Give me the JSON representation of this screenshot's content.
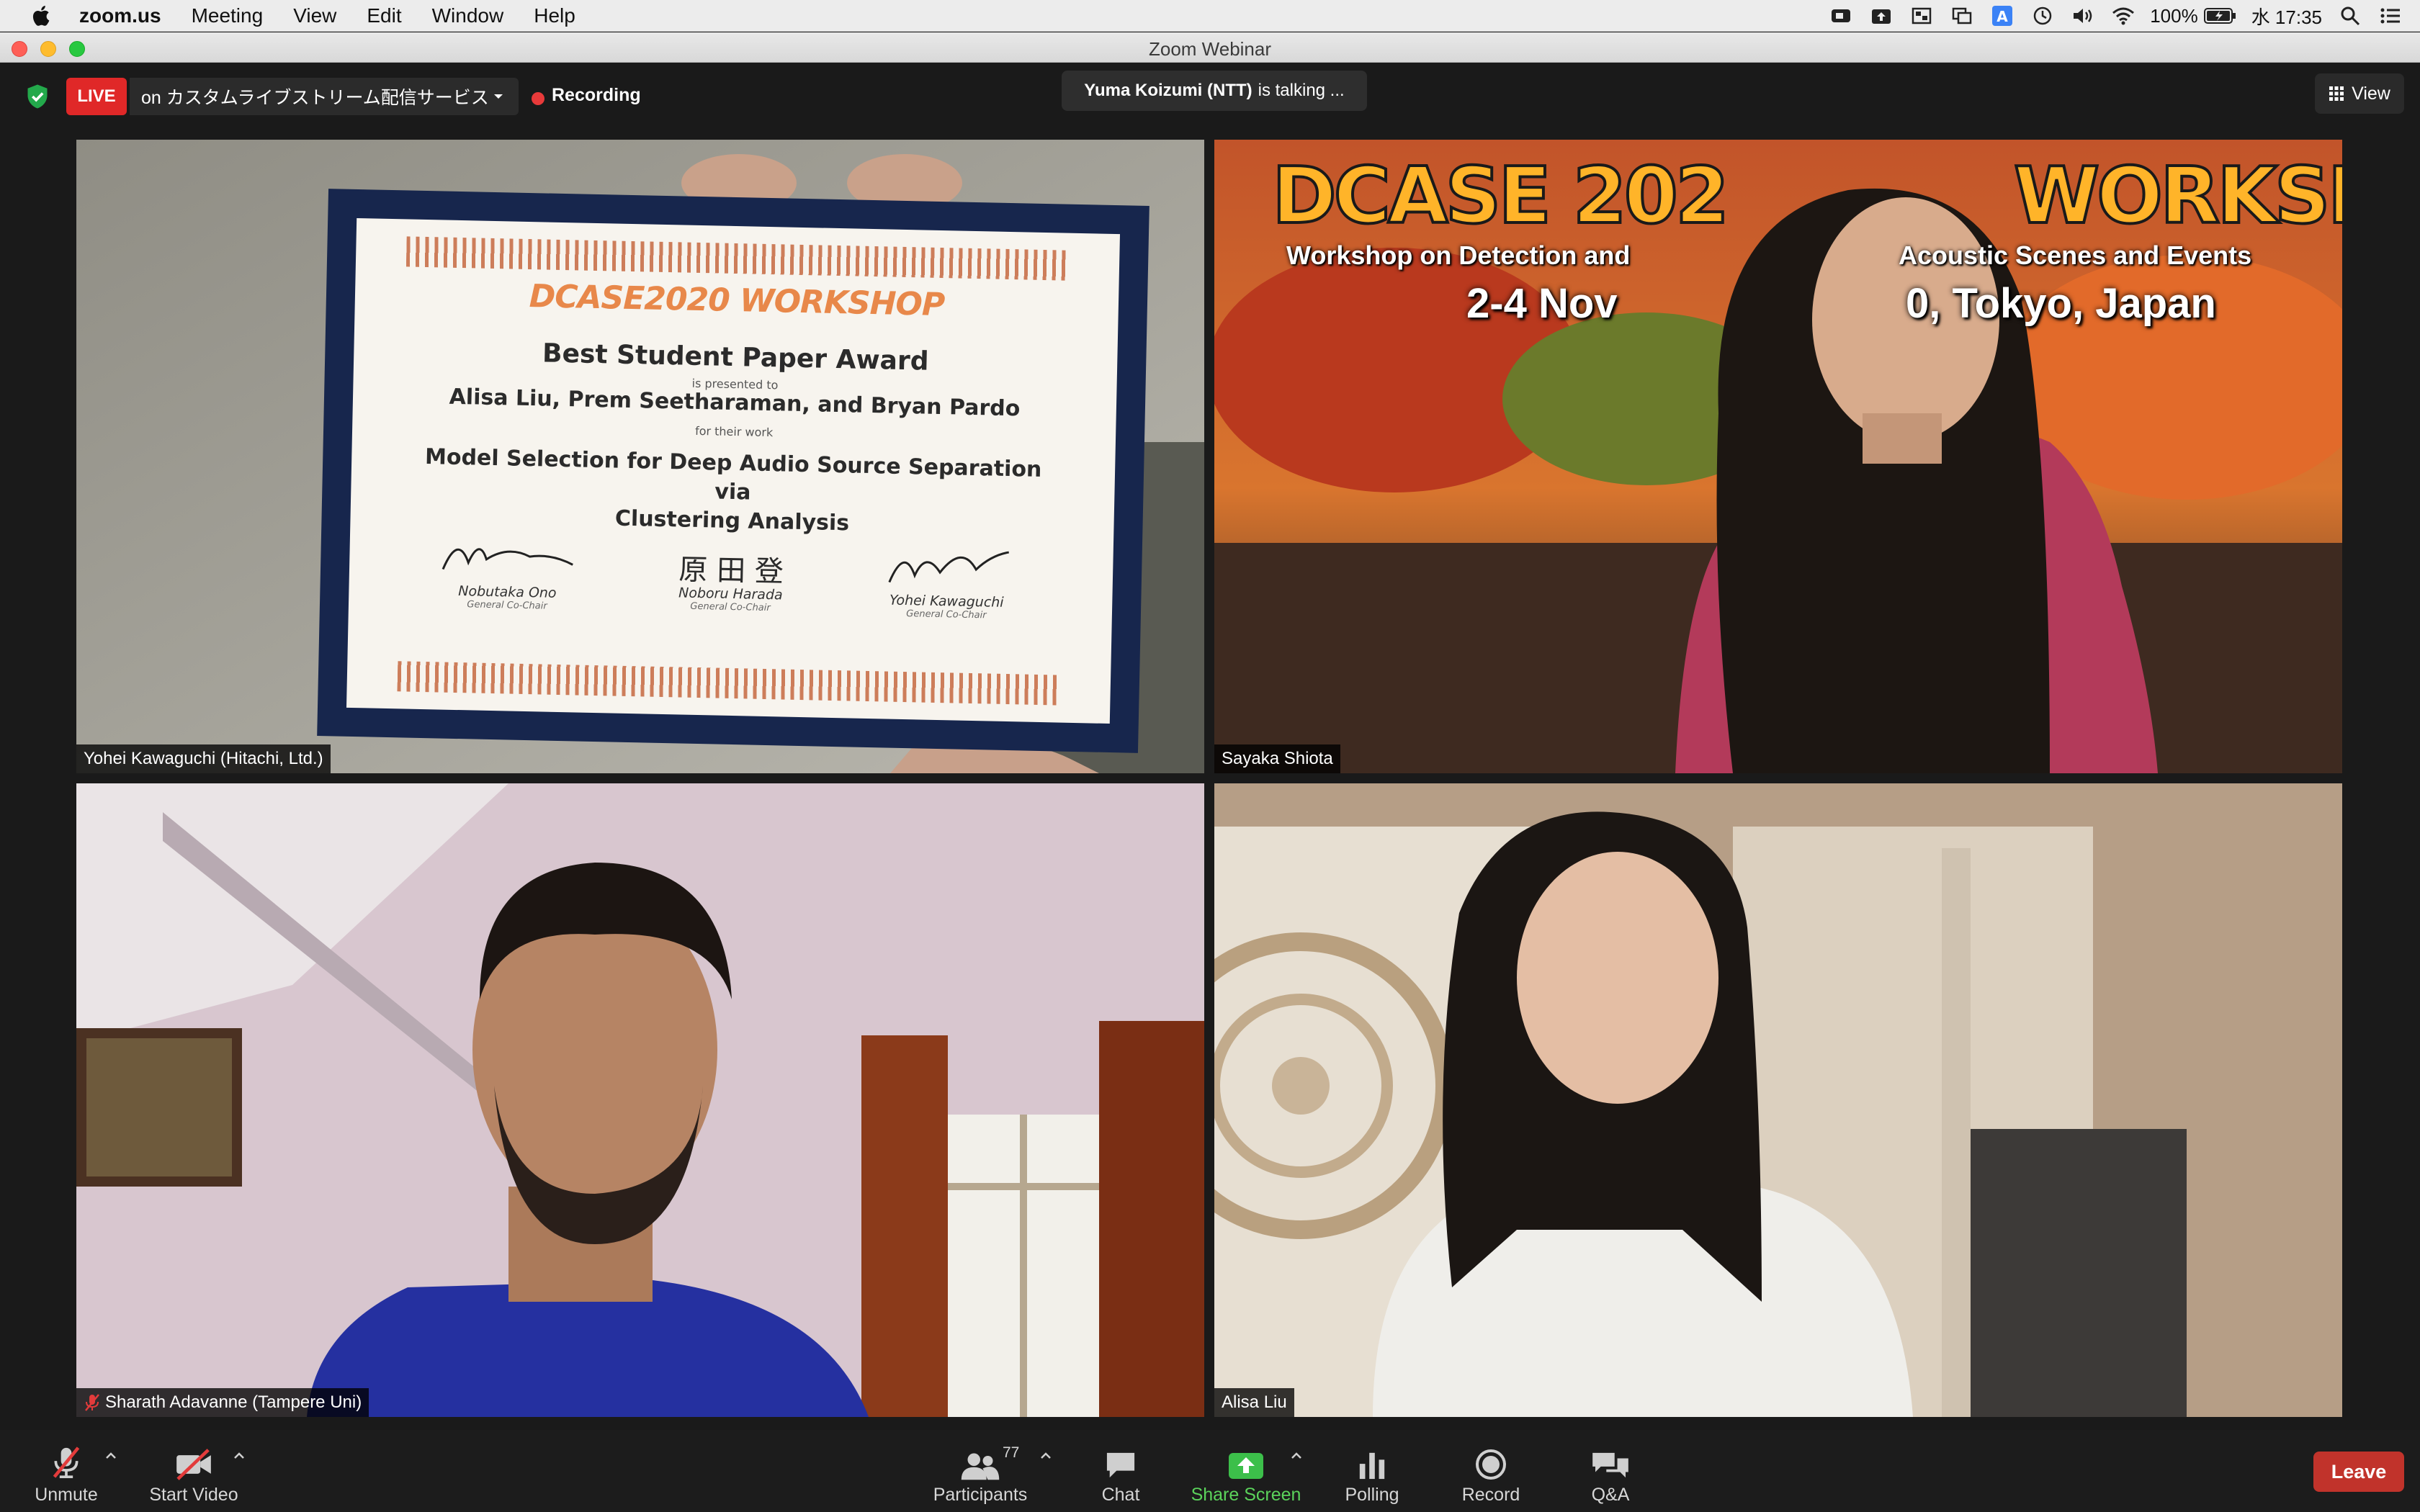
{
  "menubar": {
    "app_name": "zoom.us",
    "items": [
      "Meeting",
      "View",
      "Edit",
      "Window",
      "Help"
    ],
    "battery": "100%",
    "clock": "水 17:35"
  },
  "window": {
    "title": "Zoom Webinar"
  },
  "topbar": {
    "live_label": "LIVE",
    "stream_service": "on カスタムライブストリーム配信サービス",
    "recording_label": "Recording",
    "talking_name": "Yuma Koizumi (NTT)",
    "talking_suffix": "is talking ...",
    "view_label": "View"
  },
  "tiles": [
    {
      "name": "Yohei Kawaguchi (Hitachi, Ltd.)",
      "certificate": {
        "logo": "DCASE2020 WORKSHOP",
        "award": "Best Student Paper Award",
        "presented": "is presented to",
        "authors": "Alisa Liu, Prem Seetharaman, and Bryan Pardo",
        "for_work": "for their work",
        "work_line1": "Model Selection for Deep Audio Source Separation via",
        "work_line2": "Clustering Analysis",
        "signers": [
          {
            "name": "Nobutaka Ono",
            "role": "General Co-Chair"
          },
          {
            "name": "Noboru Harada",
            "role": "General Co-Chair"
          },
          {
            "name": "Yohei Kawaguchi",
            "role": "General Co-Chair"
          }
        ],
        "sig_kanji": "原 田 登"
      }
    },
    {
      "name": "Sayaka Shiota",
      "banner": {
        "title_left": "DCASE 202",
        "title_right": "WORKSHOP",
        "sub_left": "Workshop on Detection and",
        "sub_right": "Acoustic Scenes and Events",
        "date_left": "2-4 Nov",
        "date_right": "0, Tokyo, Japan"
      }
    },
    {
      "name": "Sharath Adavanne (Tampere Uni)",
      "muted": true
    },
    {
      "name": "Alisa Liu"
    }
  ],
  "toolbar": {
    "unmute": "Unmute",
    "start_video": "Start Video",
    "participants": "Participants",
    "participant_count": "77",
    "chat": "Chat",
    "share_screen": "Share Screen",
    "polling": "Polling",
    "record": "Record",
    "qa": "Q&A",
    "leave": "Leave"
  },
  "colors": {
    "live_red": "#e02828",
    "share_green": "#5bd35b",
    "leave_red": "#c1332b"
  }
}
